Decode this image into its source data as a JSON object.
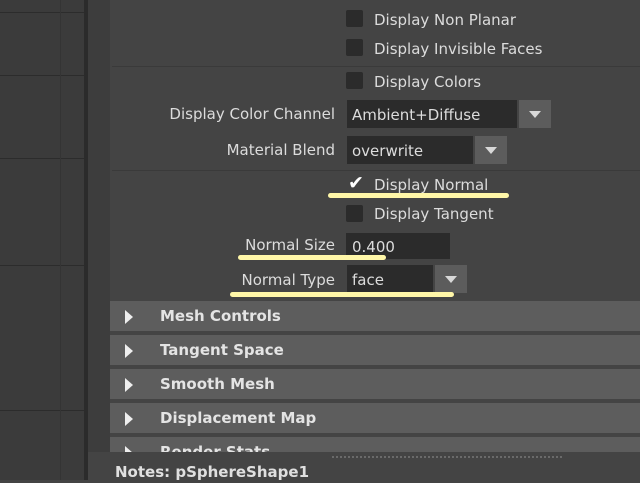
{
  "display_options": {
    "display_non_planar": {
      "label": "Display Non Planar",
      "checked": false
    },
    "display_invisible_faces": {
      "label": "Display Invisible Faces",
      "checked": false
    },
    "display_colors": {
      "label": "Display Colors",
      "checked": false
    },
    "display_color_channel": {
      "label": "Display Color Channel",
      "value": "Ambient+Diffuse"
    },
    "material_blend": {
      "label": "Material Blend",
      "value": "overwrite"
    },
    "display_normal": {
      "label": "Display Normal",
      "checked": true
    },
    "display_tangent": {
      "label": "Display Tangent",
      "checked": false
    },
    "normal_size": {
      "label": "Normal Size",
      "value": "0.400"
    },
    "normal_type": {
      "label": "Normal Type",
      "value": "face"
    }
  },
  "sections": [
    {
      "title": "Mesh Controls",
      "collapsed": true
    },
    {
      "title": "Tangent Space",
      "collapsed": true
    },
    {
      "title": "Smooth Mesh",
      "collapsed": true
    },
    {
      "title": "Displacement Map",
      "collapsed": true
    },
    {
      "title": "Render Stats",
      "collapsed": true
    }
  ],
  "notes": {
    "label": "Notes:  pSphereShape1"
  },
  "colors": {
    "highlight": "#fff7a8",
    "panel_bg": "#444444",
    "section_bg": "#5d5d5d",
    "field_bg": "#2b2b2b"
  },
  "icons": {
    "checkbox_checked": "check-icon",
    "dropdown": "dropdown-arrow-icon",
    "section_collapsed": "collapsed-arrow-icon"
  }
}
